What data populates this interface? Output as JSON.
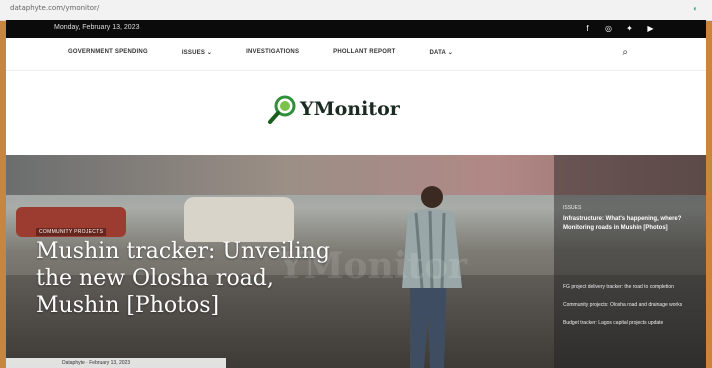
{
  "browser": {
    "url": "dataphyte.com/ymonitor/",
    "extension_icon": "◐"
  },
  "topbar": {
    "date": "Monday, February 13, 2023",
    "social": [
      {
        "name": "facebook-icon",
        "glyph": "f"
      },
      {
        "name": "instagram-icon",
        "glyph": "◎"
      },
      {
        "name": "twitter-icon",
        "glyph": "✦"
      },
      {
        "name": "youtube-icon",
        "glyph": "▶"
      }
    ]
  },
  "nav": {
    "items": [
      "GOVERNMENT SPENDING",
      "ISSUES ⌄",
      "INVESTIGATIONS",
      "PHOLLANT REPORT",
      "DATA ⌄"
    ],
    "search_glyph": "⌕"
  },
  "logo": {
    "text": "YMonitor"
  },
  "hero": {
    "badge": "COMMUNITY PROJECTS",
    "headline": "Mushin tracker: Unveiling the new Olosha road, Mushin [Photos]",
    "meta": "Dataphyte · February 13, 2023",
    "watermark": "YMonitor"
  },
  "sidebar": {
    "feature_kicker": "ISSUES",
    "feature_title": "Infrastructure: What's happening, where? Monitoring roads in Mushin [Photos]",
    "items": [
      "FG project delivery tracker: the road to completion",
      "Community projects: Olosha road and drainage works",
      "Budget tracker: Lagos capital projects update"
    ]
  }
}
